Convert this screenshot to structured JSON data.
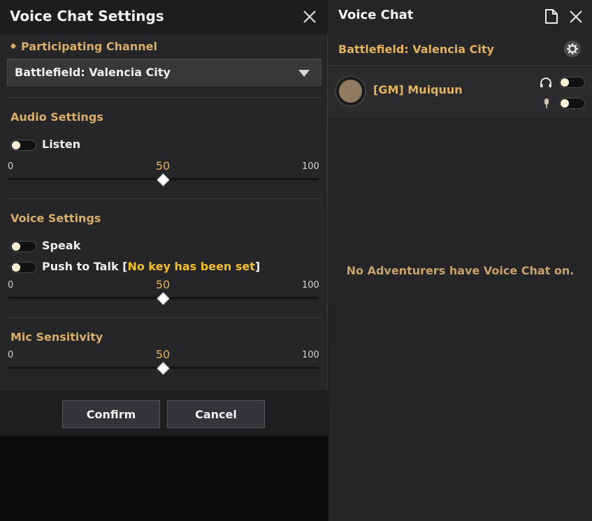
{
  "settings": {
    "title": "Voice Chat Settings",
    "participating_channel_label": "Participating Channel",
    "channel_value": "Battlefield: Valencia City",
    "audio_section": "Audio Settings",
    "listen_label": "Listen",
    "listen_on": false,
    "audio_slider": {
      "min": "0",
      "value": "50",
      "max": "100"
    },
    "voice_section": "Voice Settings",
    "speak_label": "Speak",
    "speak_on": false,
    "ptt_label": "Push to Talk [",
    "ptt_key": "No key has been set",
    "ptt_close": "]",
    "ptt_on": false,
    "voice_slider": {
      "min": "0",
      "value": "50",
      "max": "100"
    },
    "mic_section": "Mic Sensitivity",
    "mic_slider": {
      "min": "0",
      "value": "50",
      "max": "100"
    },
    "confirm_label": "Confirm",
    "cancel_label": "Cancel"
  },
  "voice_chat": {
    "title": "Voice Chat",
    "channel_name": "Battlefield: Valencia City",
    "member": {
      "name": "[GM] Muiquun",
      "headset_on": false,
      "mic_on": false
    },
    "empty_message": "No Adventurers have Voice Chat on."
  },
  "icons": [
    "close-icon",
    "note-icon",
    "gear-icon",
    "headphones-icon",
    "microphone-icon",
    "chevron-down-icon"
  ],
  "colors": {
    "accent": "#e3b25e",
    "key_highlight": "#f2c02e",
    "panel": "#262628"
  }
}
